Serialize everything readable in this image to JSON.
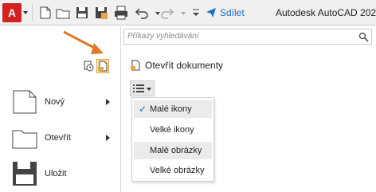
{
  "toolbar": {
    "app_letter": "A",
    "share_label": "Sdílet",
    "title": "Autodesk AutoCAD 202"
  },
  "search": {
    "placeholder": "Příkazy vyhledávání"
  },
  "panel": {
    "header": "Otevřít dokumenty"
  },
  "commands": [
    {
      "label": "Nový"
    },
    {
      "label": "Otevřít"
    },
    {
      "label": "Uložit"
    }
  ],
  "view_menu": {
    "items": [
      {
        "label": "Malé ikony",
        "checked": true
      },
      {
        "label": "Velké ikony",
        "checked": false
      },
      {
        "label": "Malé obrázky",
        "checked": false
      },
      {
        "label": "Velké obrázky",
        "checked": false
      }
    ]
  },
  "colors": {
    "accent": "#1a6fc4",
    "app_button": "#d42020",
    "pointer_arrow": "#e07a2a"
  }
}
